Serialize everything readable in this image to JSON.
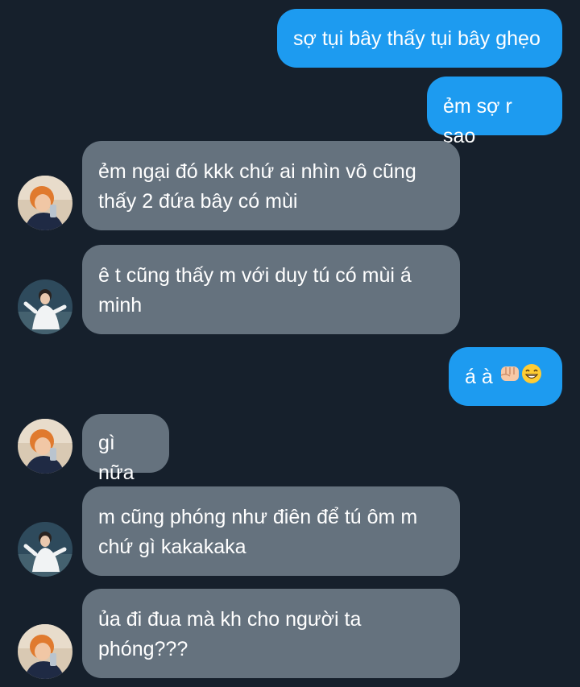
{
  "messages": [
    {
      "side": "out",
      "text": "sợ tụi bây thấy tụi bây ghẹo"
    },
    {
      "side": "out",
      "text": "ẻm sợ r sao"
    },
    {
      "side": "in",
      "avatar": "avatar-orange-hair",
      "text": "ẻm ngại đó kkk chứ ai nhìn vô cũng thấy 2 đứa bây có mùi"
    },
    {
      "side": "in",
      "avatar": "avatar-white-shirt",
      "text": "ê t cũng thấy m với duy tú có mùi á minh"
    },
    {
      "side": "out",
      "text": "á à",
      "emojis": [
        "raised-fist-emoji",
        "grinning-face-emoji"
      ]
    },
    {
      "side": "in",
      "avatar": "avatar-orange-hair",
      "text": "gì nữa"
    },
    {
      "side": "in",
      "avatar": "avatar-white-shirt",
      "text": "m cũng phóng như điên để tú ôm m chứ gì kakakaka"
    },
    {
      "side": "in",
      "avatar": "avatar-orange-hair",
      "text": "ủa đi đua mà kh cho người ta phóng???"
    }
  ],
  "colors": {
    "background": "#16202c",
    "outgoing_bubble": "#1d9bf0",
    "incoming_bubble": "#65727e"
  }
}
